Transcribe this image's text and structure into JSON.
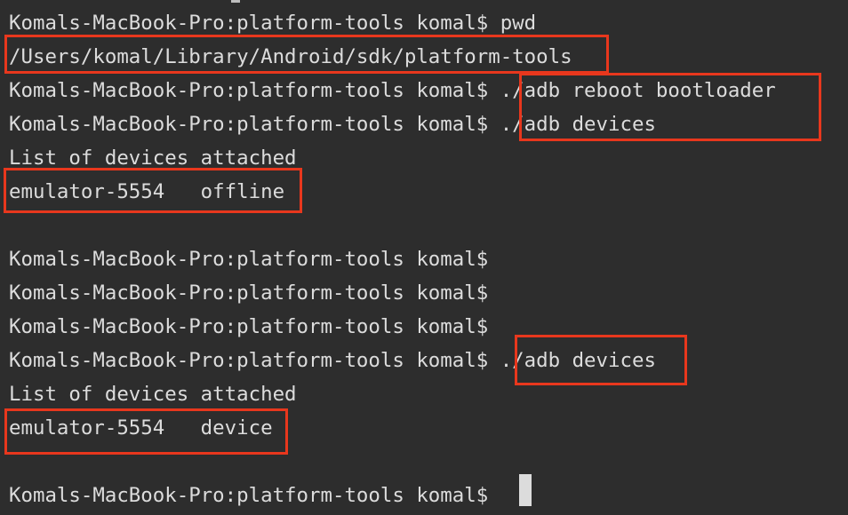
{
  "terminal": {
    "lines": [
      "Komals-MacBook-Pro:platform-tools komal$ pwd",
      "/Users/komal/Library/Android/sdk/platform-tools",
      "Komals-MacBook-Pro:platform-tools komal$ ./adb reboot bootloader",
      "Komals-MacBook-Pro:platform-tools komal$ ./adb devices",
      "List of devices attached",
      "emulator-5554   offline",
      "",
      "Komals-MacBook-Pro:platform-tools komal$",
      "Komals-MacBook-Pro:platform-tools komal$",
      "Komals-MacBook-Pro:platform-tools komal$",
      "Komals-MacBook-Pro:platform-tools komal$ ./adb devices",
      "List of devices attached",
      "emulator-5554   device",
      "",
      "Komals-MacBook-Pro:platform-tools komal$"
    ]
  },
  "colors": {
    "background": "#2d2d2d",
    "text": "#dcdcdc",
    "highlight_border": "#e8371d"
  }
}
